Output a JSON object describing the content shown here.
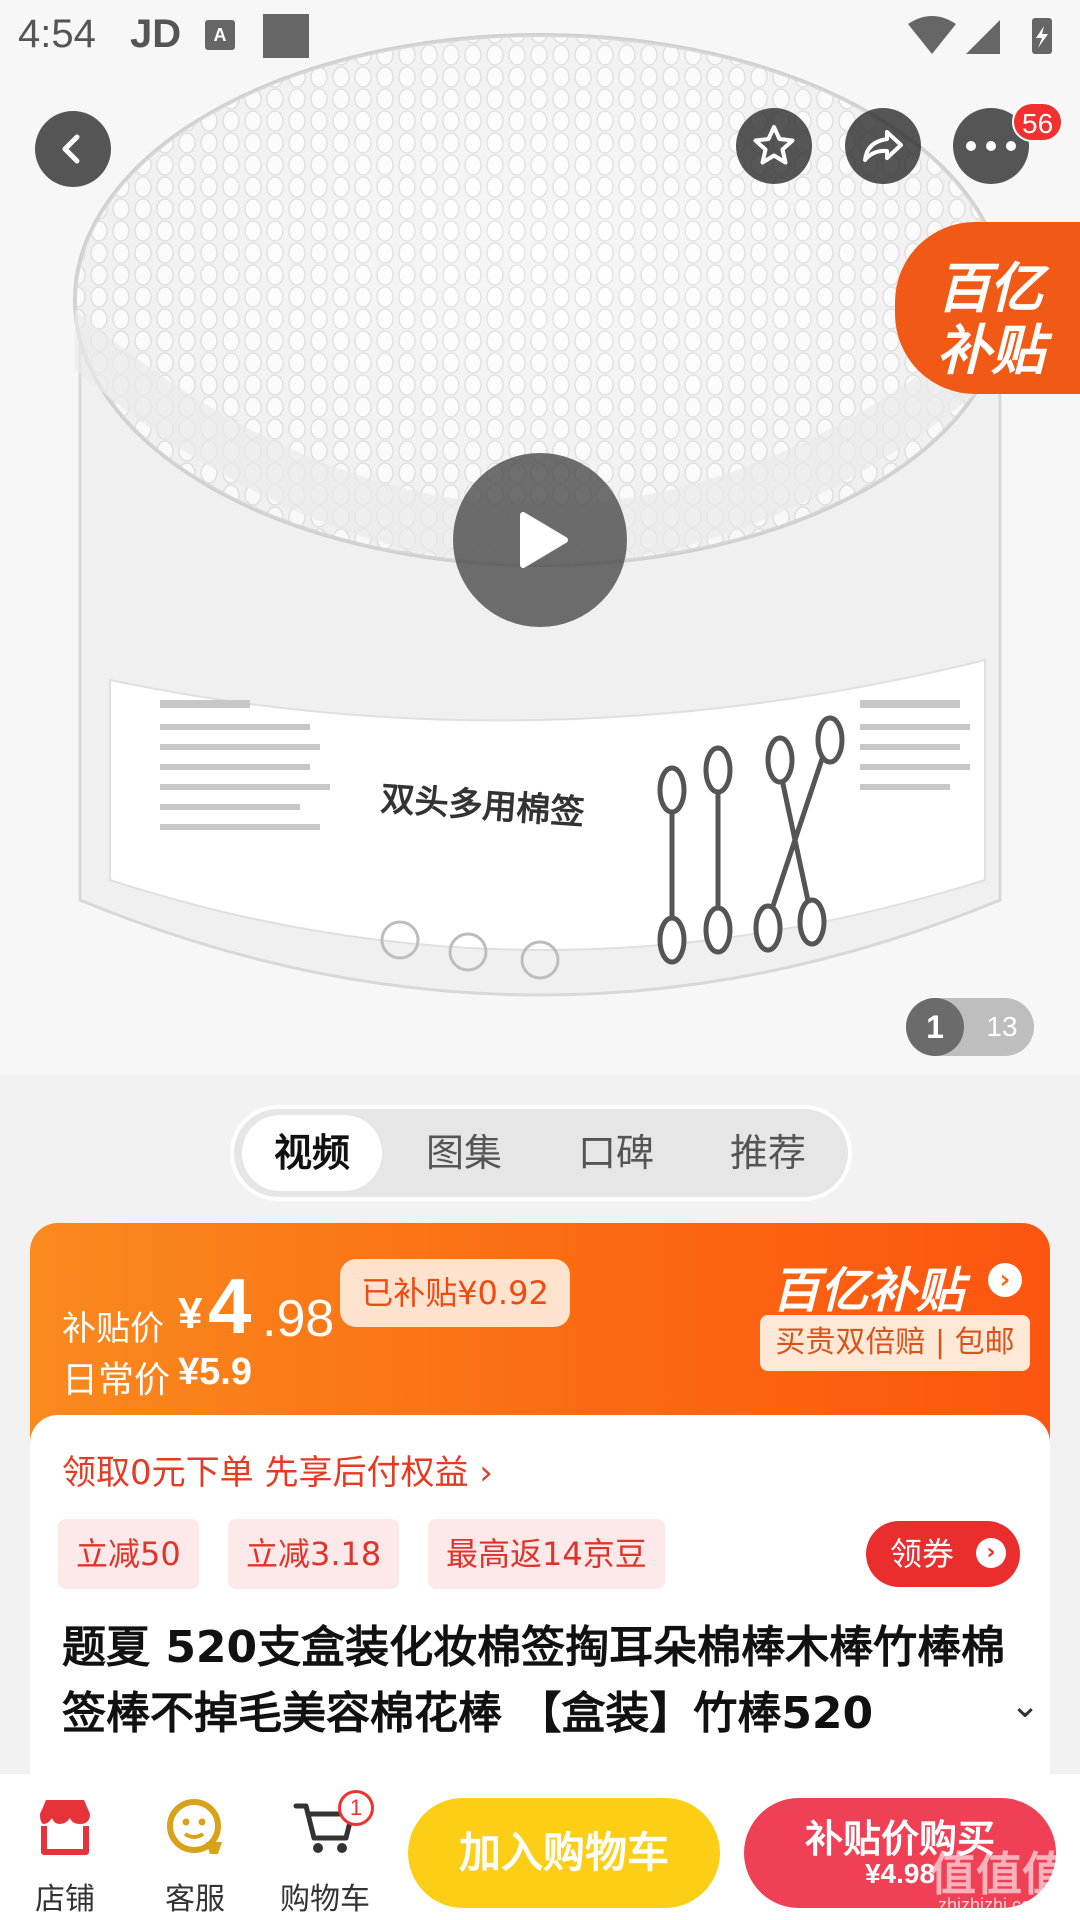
{
  "status_bar": {
    "time": "4:54",
    "app": "JD",
    "a_icon": "A"
  },
  "top_bar": {
    "cart_count": "56"
  },
  "hero": {
    "badge_line1": "百亿",
    "badge_line2": "补贴",
    "product_label": "双头多用棉签",
    "pager_current": "1",
    "pager_total": "13"
  },
  "tabs": [
    "视频",
    "图集",
    "口碑",
    "推荐"
  ],
  "price": {
    "label": "补贴价",
    "yen": "¥",
    "integer": "4",
    "decimal": ".98",
    "subsidy_tag": "已补贴¥0.92",
    "daily_label": "日常价",
    "daily_price": "¥5.9",
    "brand": "百亿补贴",
    "guarantee": "买贵双倍赔 | 包邮"
  },
  "offers": {
    "pay_later": "领取0元下单 先享后付权益 ›",
    "coupons": [
      "立减50",
      "立减3.18",
      "最高返14京豆"
    ],
    "get_coupon": "领券"
  },
  "product": {
    "title": "题夏 520支盒装化妆棉签掏耳朵棉棒木棒竹棒棉签棒不掉毛美容棉花棒 【盒装】竹棒520"
  },
  "bottom_bar": {
    "store": "店铺",
    "service": "客服",
    "cart": "购物车",
    "cart_badge": "1",
    "add_to_cart": "加入购物车",
    "buy_line1": "补贴价购买",
    "buy_line2": "¥4.98"
  },
  "watermark": {
    "text": "值值值",
    "url": "zhizhizhi.com"
  },
  "colors": {
    "accent_orange": "#fb6a12",
    "red": "#ea2d2d",
    "yellow": "#fccf16"
  }
}
